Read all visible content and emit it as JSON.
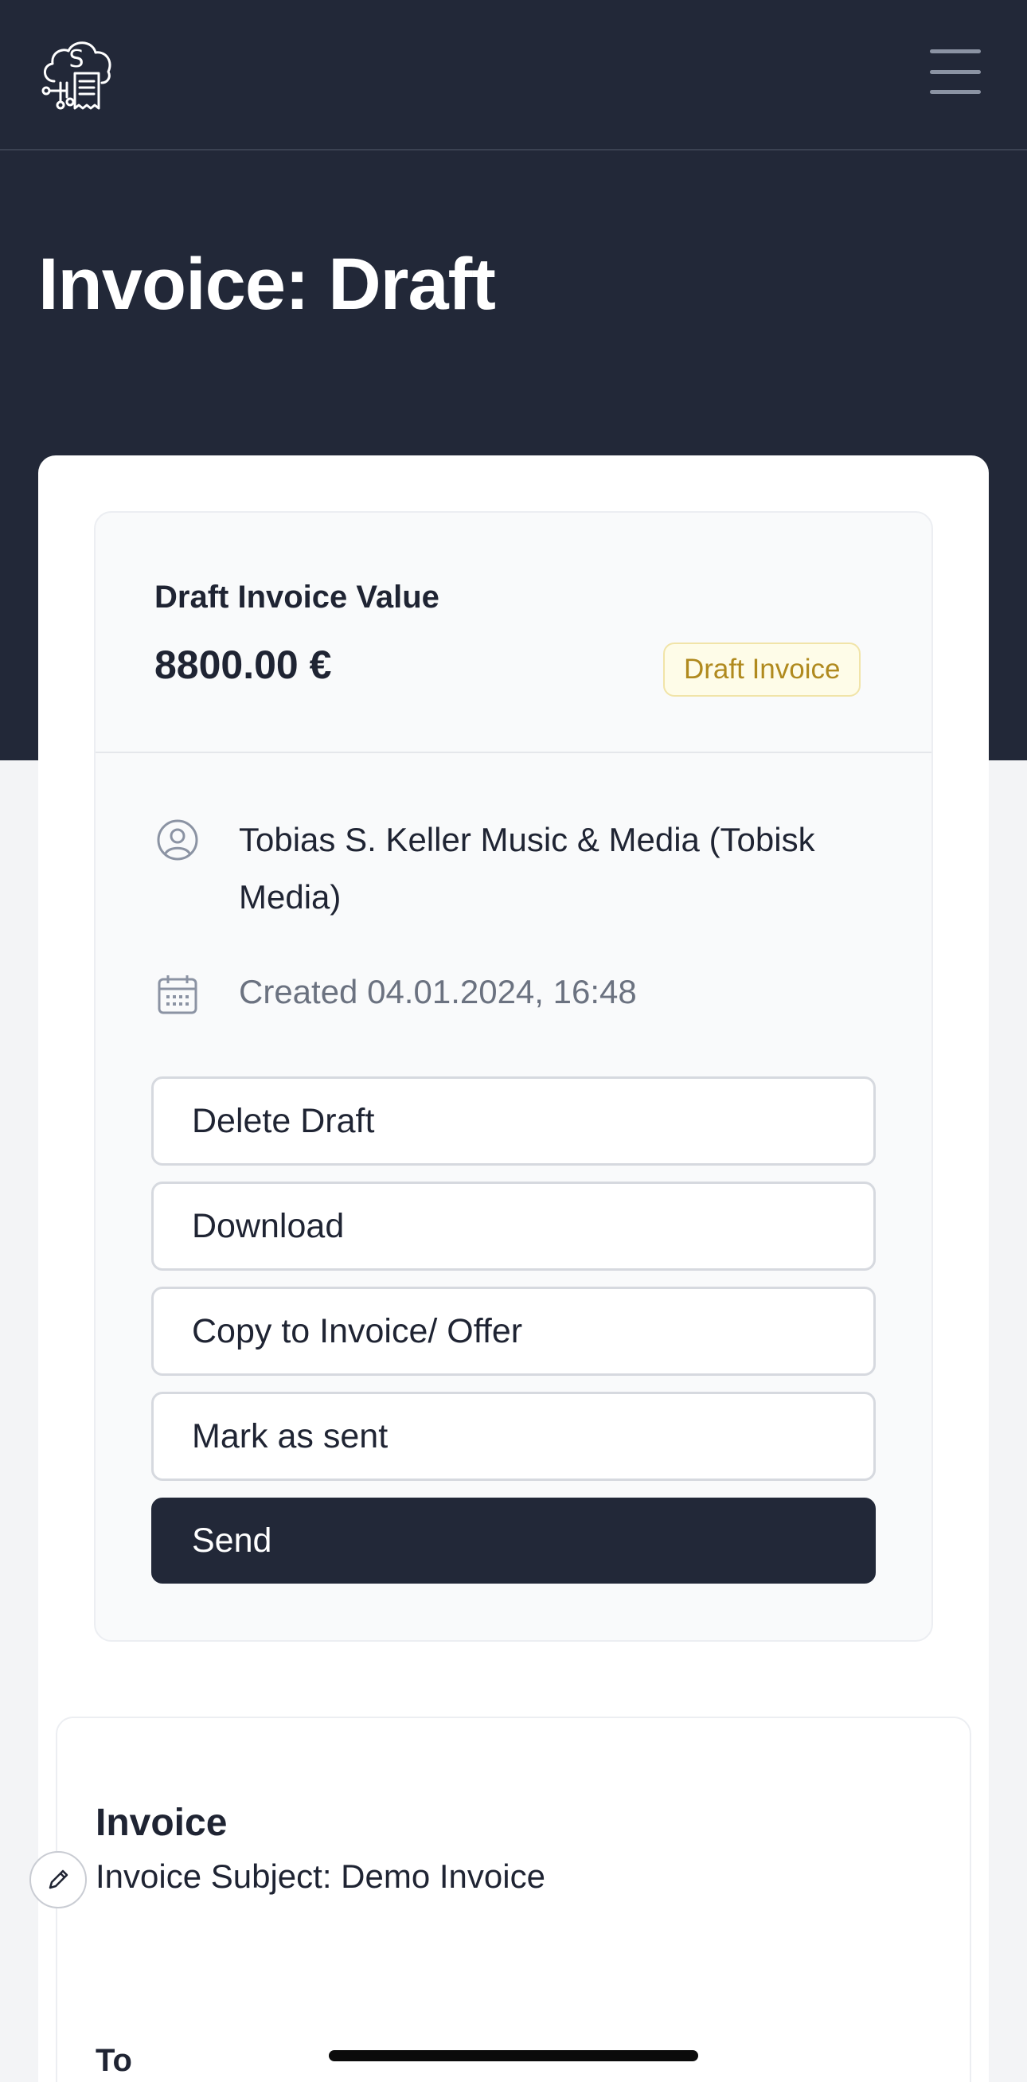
{
  "header": {
    "logo_icon": "cloud-invoice-logo-icon",
    "menu_icon": "hamburger-menu-icon"
  },
  "page": {
    "title": "Invoice: Draft"
  },
  "summary": {
    "label": "Draft Invoice Value",
    "value": "8800.00 €",
    "badge": "Draft Invoice",
    "client": "Tobias S. Keller Music & Media (Tobisk Media)",
    "created": "Created 04.01.2024, 16:48"
  },
  "actions": {
    "delete": "Delete Draft",
    "download": "Download",
    "copy": "Copy to Invoice/ Offer",
    "mark_sent": "Mark as sent",
    "send": "Send"
  },
  "document": {
    "type": "Invoice",
    "subject": "Invoice Subject: Demo Invoice",
    "to_label": "To"
  },
  "colors": {
    "header_bg": "#222838",
    "badge_text": "#b08a1e",
    "badge_bg": "#fefce8",
    "primary_button": "#222838"
  }
}
